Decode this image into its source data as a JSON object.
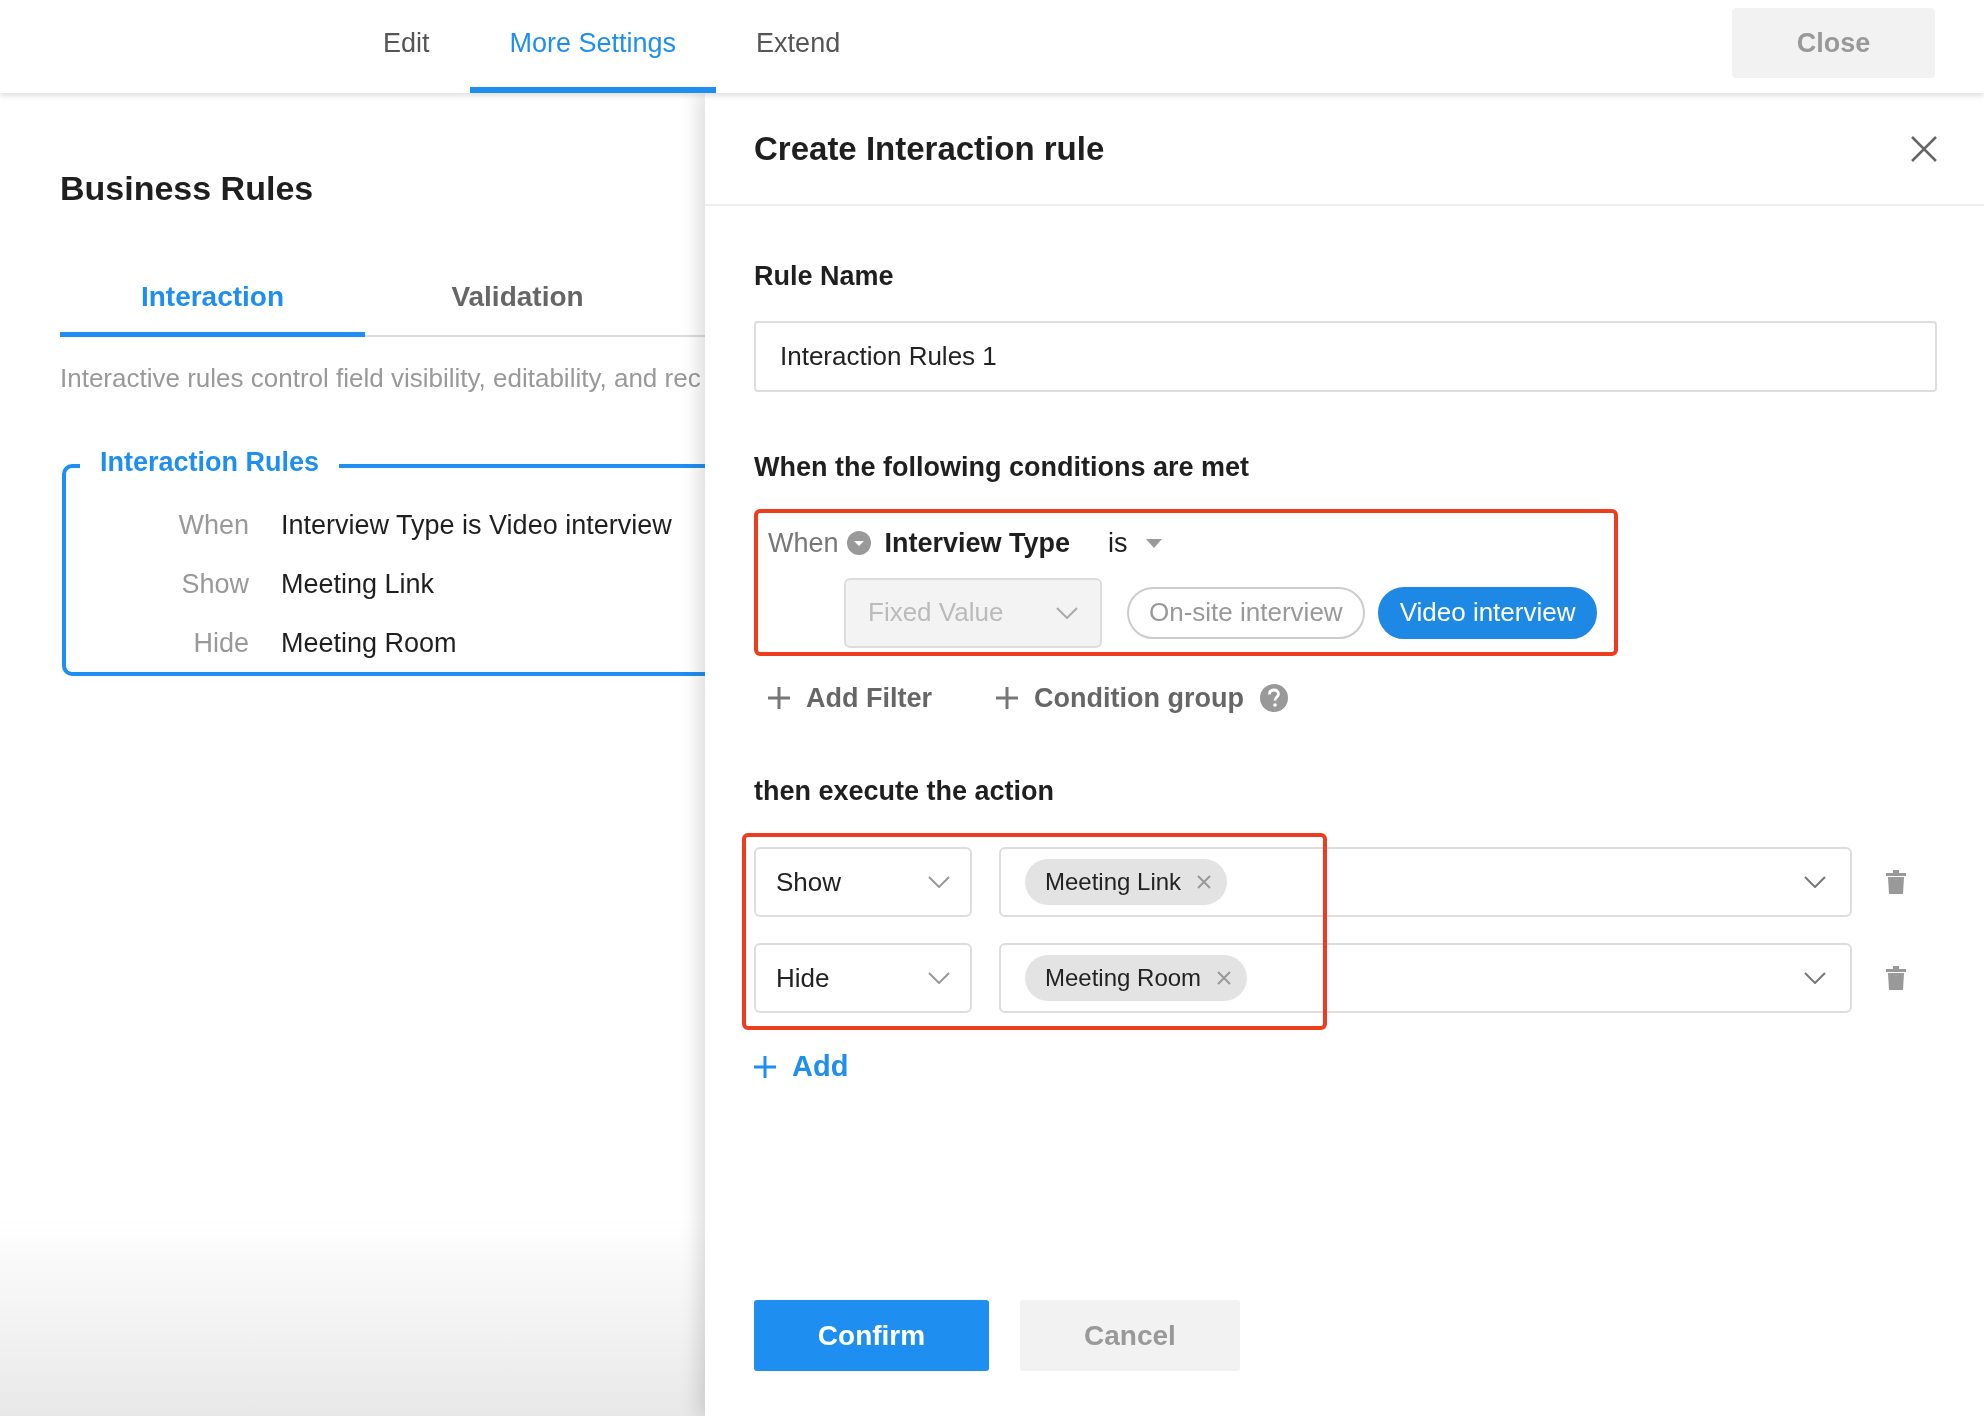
{
  "top_tabs": [
    {
      "label": "Edit",
      "selected": false
    },
    {
      "label": "More Settings",
      "selected": true
    },
    {
      "label": "Extend",
      "selected": false
    }
  ],
  "close_button": {
    "label": "Close",
    "disabled": true
  },
  "business_rules": {
    "title": "Business Rules",
    "tabs": [
      {
        "label": "Interaction",
        "selected": true
      },
      {
        "label": "Validation",
        "selected": false
      }
    ],
    "description": "Interactive rules control field visibility, editability, and rec",
    "rule_card": {
      "title": "Interaction Rules",
      "rows": [
        {
          "label": "When",
          "value": "Interview Type is Video interview"
        },
        {
          "label": "Show",
          "value": "Meeting Link"
        },
        {
          "label": "Hide",
          "value": "Meeting Room"
        }
      ]
    }
  },
  "drawer": {
    "title": "Create Interaction rule",
    "rule_name": {
      "label": "Rule Name",
      "value": "Interaction Rules 1"
    },
    "conditions": {
      "heading": "When the following conditions are met",
      "highlighted": true,
      "prefix": "When",
      "field": "Interview Type",
      "operator": "is",
      "value_source": {
        "value": "Fixed Value",
        "disabled": true
      },
      "options": [
        {
          "label": "On-site interview",
          "selected": false
        },
        {
          "label": "Video interview",
          "selected": true
        }
      ]
    },
    "condition_links": [
      {
        "kind": "add",
        "label": "Add Filter"
      },
      {
        "kind": "group",
        "label": "Condition group"
      }
    ],
    "actions": {
      "heading": "then execute the action",
      "highlighted": true,
      "rows": [
        {
          "action": "Show",
          "fields": [
            "Meeting Link"
          ]
        },
        {
          "action": "Hide",
          "fields": [
            "Meeting Room"
          ]
        }
      ],
      "add_label": "Add"
    },
    "footer": [
      {
        "kind": "primary",
        "label": "Confirm"
      },
      {
        "kind": "secondary",
        "label": "Cancel"
      }
    ]
  }
}
